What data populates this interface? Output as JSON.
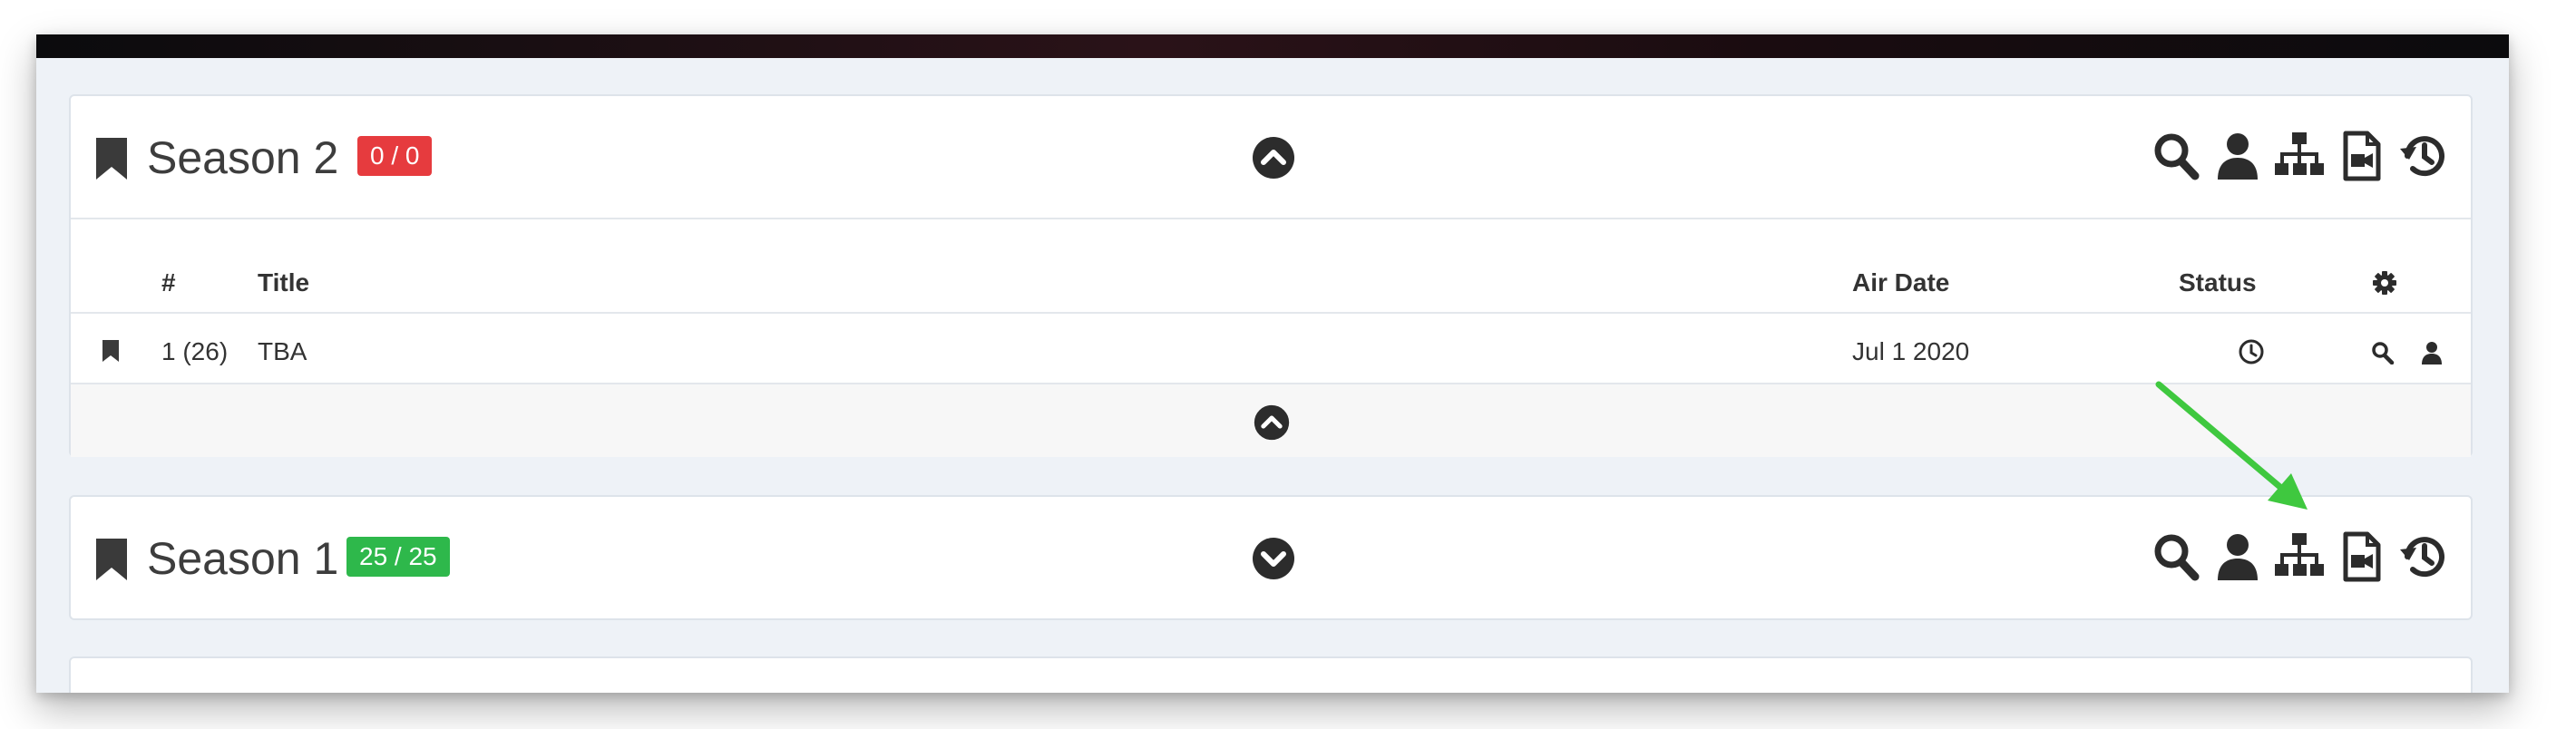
{
  "seasons": [
    {
      "title": "Season 2",
      "badge": "0 / 0",
      "badge_color": "#e63b3e",
      "collapse_state": "expanded",
      "columns": {
        "number": "#",
        "title": "Title",
        "air_date": "Air Date",
        "status": "Status"
      },
      "episodes": [
        {
          "number": "1 (26)",
          "title": "TBA",
          "air_date": "Jul 1 2020",
          "status_icon": "clock-icon"
        }
      ]
    },
    {
      "title": "Season 1",
      "badge": "25 / 25",
      "badge_color": "#2eb84b",
      "collapse_state": "collapsed"
    }
  ],
  "header_icons": [
    "search-icon",
    "user-icon",
    "hierarchy-icon",
    "file-video-icon",
    "history-icon"
  ],
  "colors": {
    "annotation_arrow": "#3fc83f",
    "icon": "#2c2c2c",
    "background": "#eef2f7"
  }
}
